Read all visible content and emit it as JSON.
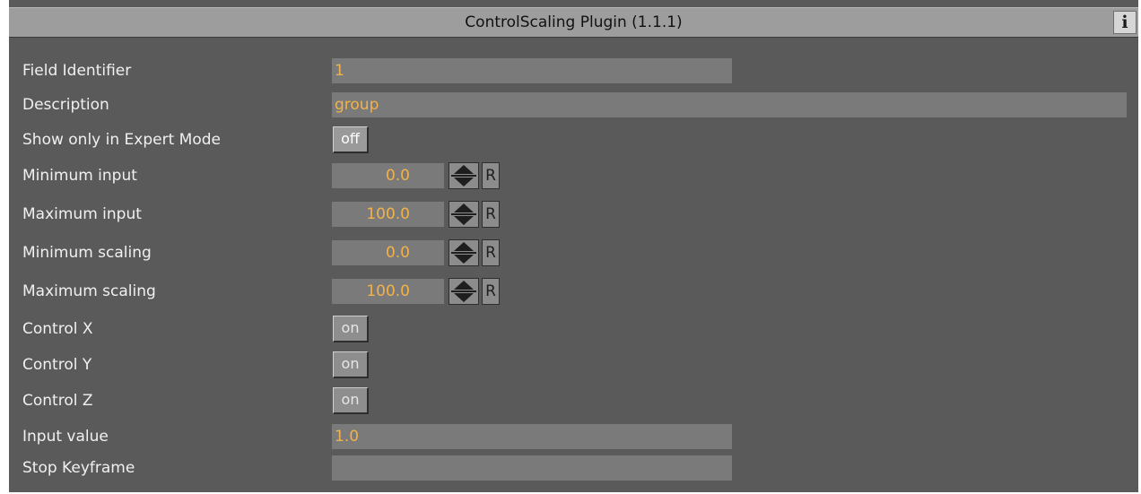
{
  "header": {
    "title": "ControlScaling Plugin (1.1.1)",
    "info_button": "i"
  },
  "fields": {
    "field_identifier": {
      "label": "Field Identifier",
      "value": "1"
    },
    "description": {
      "label": "Description",
      "value": "group"
    },
    "expert_mode": {
      "label": "Show only in Expert Mode",
      "value": "off"
    },
    "minimum_input": {
      "label": "Minimum input",
      "value": "0.0",
      "reset": "R"
    },
    "maximum_input": {
      "label": "Maximum input",
      "value": "100.0",
      "reset": "R"
    },
    "minimum_scaling": {
      "label": "Minimum scaling",
      "value": "0.0",
      "reset": "R"
    },
    "maximum_scaling": {
      "label": "Maximum scaling",
      "value": "100.0",
      "reset": "R"
    },
    "control_x": {
      "label": "Control X",
      "value": "on"
    },
    "control_y": {
      "label": "Control Y",
      "value": "on"
    },
    "control_z": {
      "label": "Control Z",
      "value": "on"
    },
    "input_value": {
      "label": "Input value",
      "value": "1.0"
    },
    "stop_keyframe": {
      "label": "Stop Keyframe",
      "value": ""
    }
  },
  "colors": {
    "panel_background": "#5a5a5a",
    "header_background": "#9d9d9d",
    "field_background": "#7a7a7a",
    "value_text": "#f2b24a",
    "label_text": "#f0f0f0"
  },
  "icons": {
    "info": "info-icon",
    "spinner": "spinner-arrows-icon"
  }
}
